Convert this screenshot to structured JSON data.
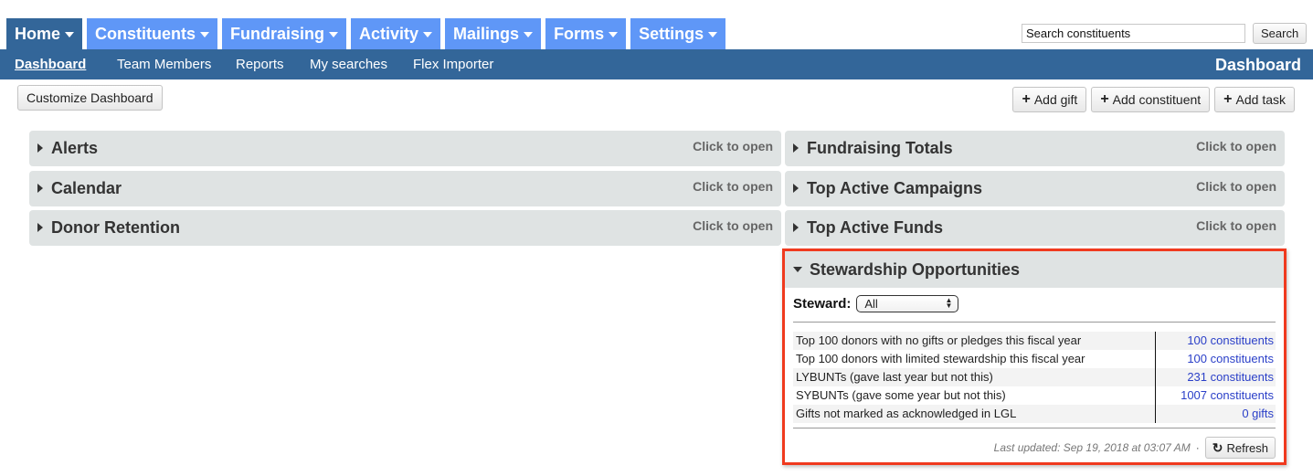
{
  "topnav": {
    "tabs": [
      {
        "label": "Home",
        "active": true
      },
      {
        "label": "Constituents",
        "active": false
      },
      {
        "label": "Fundraising",
        "active": false
      },
      {
        "label": "Activity",
        "active": false
      },
      {
        "label": "Mailings",
        "active": false
      },
      {
        "label": "Forms",
        "active": false
      },
      {
        "label": "Settings",
        "active": false
      }
    ],
    "search": {
      "placeholder": "Search constituents",
      "button_label": "Search"
    }
  },
  "subnav": {
    "items": [
      {
        "label": "Dashboard",
        "active": true
      },
      {
        "label": "Team Members",
        "active": false
      },
      {
        "label": "Reports",
        "active": false
      },
      {
        "label": "My searches",
        "active": false
      },
      {
        "label": "Flex Importer",
        "active": false
      }
    ],
    "page_title": "Dashboard"
  },
  "toolbar": {
    "customize_label": "Customize Dashboard",
    "add_gift_label": "Add gift",
    "add_constituent_label": "Add constituent",
    "add_task_label": "Add task",
    "plus_icon": "+"
  },
  "panels": {
    "left": [
      {
        "title": "Alerts",
        "hint": "Click to open"
      },
      {
        "title": "Calendar",
        "hint": "Click to open"
      },
      {
        "title": "Donor Retention",
        "hint": "Click to open"
      }
    ],
    "right": [
      {
        "title": "Fundraising Totals",
        "hint": "Click to open"
      },
      {
        "title": "Top Active Campaigns",
        "hint": "Click to open"
      },
      {
        "title": "Top Active Funds",
        "hint": "Click to open"
      }
    ]
  },
  "stewardship": {
    "title": "Stewardship Opportunities",
    "steward_label": "Steward:",
    "steward_selected": "All",
    "rows": [
      {
        "description": "Top 100 donors with no gifts or pledges this fiscal year",
        "value": "100 constituents"
      },
      {
        "description": "Top 100 donors with limited stewardship this fiscal year",
        "value": "100 constituents"
      },
      {
        "description": "LYBUNTs (gave last year but not this)",
        "value": "231 constituents"
      },
      {
        "description": "SYBUNTs (gave some year but not this)",
        "value": "1007 constituents"
      },
      {
        "description": "Gifts not marked as acknowledged in LGL",
        "value": "0 gifts"
      }
    ],
    "last_updated": "Last updated: Sep 19, 2018 at 03:07 AM",
    "separator": "·",
    "refresh_label": "Refresh",
    "refresh_icon": "↻"
  },
  "colors": {
    "nav_active": "#336699",
    "nav_tab": "#5f97f7",
    "link": "#2a3fc8",
    "highlight_border": "#f03a1f",
    "panel_bg": "#dfe3e3"
  }
}
